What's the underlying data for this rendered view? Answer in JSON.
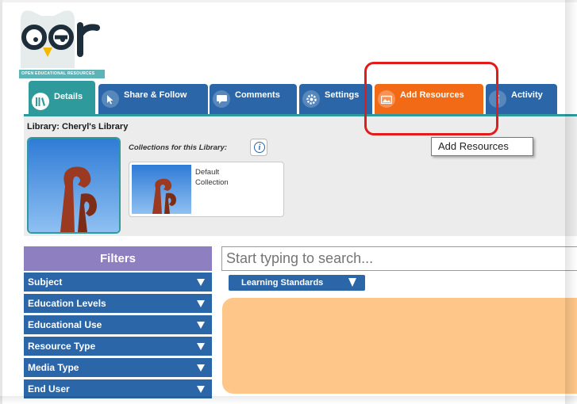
{
  "logo": {
    "text": "oer",
    "tagline": "OPEN EDUCATIONAL RESOURCES"
  },
  "tabs": [
    {
      "label": "Details",
      "icon": "library-icon"
    },
    {
      "label": "Share & Follow",
      "icon": "cursor-icon"
    },
    {
      "label": "Comments",
      "icon": "comment-icon"
    },
    {
      "label": "Settings",
      "icon": "gear-icon"
    },
    {
      "label": "Add Resources",
      "icon": "add-resource-icon"
    },
    {
      "label": "Activity",
      "icon": "activity-icon"
    }
  ],
  "tooltip": "Add Resources",
  "library": {
    "title": "Library: Cheryl's Library",
    "collections_label": "Collections for this Library:",
    "info_glyph": "i",
    "collection_name": "Default Collection"
  },
  "filters": {
    "title": "Filters",
    "items": [
      "Subject",
      "Education Levels",
      "Educational Use",
      "Resource Type",
      "Media Type",
      "End User"
    ]
  },
  "search": {
    "placeholder": "Start typing to search..."
  },
  "learning_standards_label": "Learning Standards",
  "colors": {
    "details_tab": "#2e9a9c",
    "nav_tab": "#2a66a8",
    "active_tab": "#f26a16",
    "filters_header": "#8e7fc1",
    "highlight": "#e21b1b",
    "results_panel": "#fec688"
  }
}
